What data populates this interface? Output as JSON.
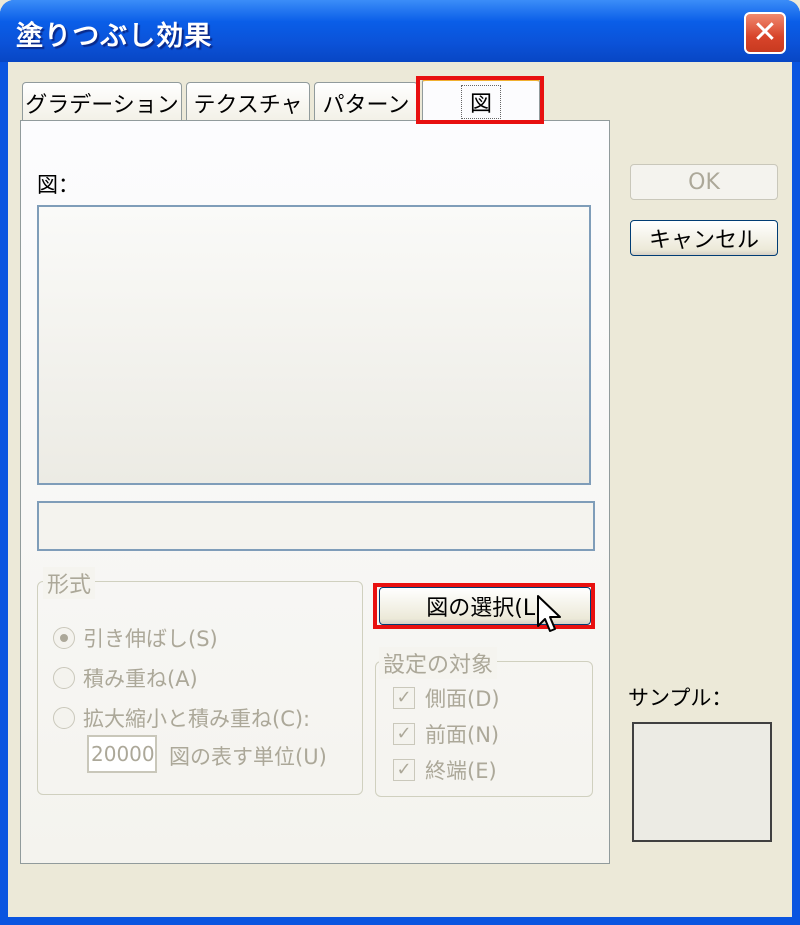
{
  "window": {
    "title": "塗りつぶし効果",
    "close_symbol": "✕"
  },
  "tabs": [
    {
      "label": "グラデーション"
    },
    {
      "label": "テクスチャ"
    },
    {
      "label": "パターン"
    },
    {
      "label": "図",
      "active": true
    }
  ],
  "picture": {
    "label": "図："
  },
  "buttons": {
    "ok": "OK",
    "cancel": "キャンセル",
    "select_picture": "図の選択(L)"
  },
  "format_group": {
    "title": "形式",
    "options": [
      {
        "label": "引き伸ばし(S)",
        "checked": true
      },
      {
        "label": "積み重ね(A)",
        "checked": false
      },
      {
        "label": "拡大縮小と積み重ね(C):",
        "checked": false
      }
    ],
    "scale_value": "20000",
    "unit_label": "図の表す単位(U)"
  },
  "target_group": {
    "title": "設定の対象",
    "items": [
      {
        "label": "側面(D)",
        "checked": true
      },
      {
        "label": "前面(N)",
        "checked": true
      },
      {
        "label": "終端(E)",
        "checked": true
      }
    ]
  },
  "sample": {
    "label": "サンプル："
  },
  "colors": {
    "title_bar": "#0b52d8",
    "highlight": "#e81010",
    "dialog_bg": "#ece9d8"
  }
}
